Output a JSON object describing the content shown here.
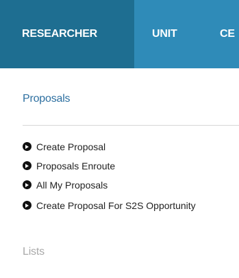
{
  "nav": {
    "tabs": [
      {
        "label": "RESEARCHER"
      },
      {
        "label": "UNIT"
      },
      {
        "label": "CE"
      }
    ]
  },
  "proposals": {
    "title": "Proposals",
    "items": [
      {
        "label": "Create Proposal",
        "icon": "circle-chevron-right-icon"
      },
      {
        "label": "Proposals Enroute",
        "icon": "circle-chevron-right-icon"
      },
      {
        "label": "All My Proposals",
        "icon": "circle-chevron-right-icon"
      },
      {
        "label": "Create Proposal For S2S Opportunity",
        "icon": "circle-chevron-right-icon"
      }
    ]
  },
  "lists": {
    "title": "Lists"
  },
  "colors": {
    "nav_bg": "#2f8bb8",
    "nav_active_bg": "#1e6e91",
    "section_title": "#2d6fa0",
    "muted_title": "#a9a9a9"
  }
}
